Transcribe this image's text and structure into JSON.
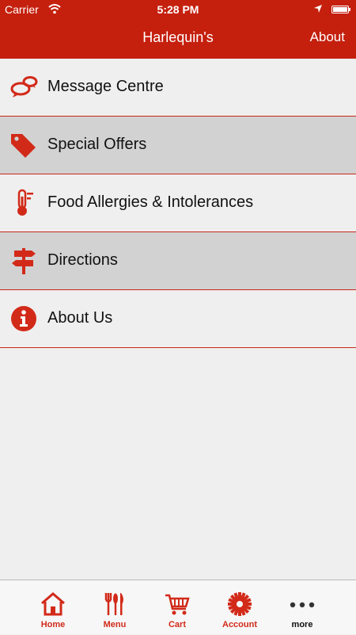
{
  "status_bar": {
    "carrier": "Carrier",
    "time": "5:28 PM"
  },
  "nav": {
    "title": "Harlequin's",
    "about_label": "About"
  },
  "menu": {
    "items": [
      {
        "label": "Message Centre",
        "icon": "chat-bubbles-icon"
      },
      {
        "label": "Special Offers",
        "icon": "price-tag-icon"
      },
      {
        "label": "Food Allergies & Intolerances",
        "icon": "thermometer-icon"
      },
      {
        "label": "Directions",
        "icon": "signpost-icon"
      },
      {
        "label": "About Us",
        "icon": "info-icon"
      }
    ]
  },
  "tabbar": {
    "items": [
      {
        "label": "Home",
        "icon": "home-icon"
      },
      {
        "label": "Menu",
        "icon": "cutlery-icon"
      },
      {
        "label": "Cart",
        "icon": "cart-icon"
      },
      {
        "label": "Account",
        "icon": "gear-icon"
      },
      {
        "label": "more",
        "icon": "more-dots-icon"
      }
    ]
  },
  "colors": {
    "brand": "#c5200e",
    "accent": "#d22a19",
    "row_alt": "#d2d2d2",
    "background": "#efefef"
  }
}
